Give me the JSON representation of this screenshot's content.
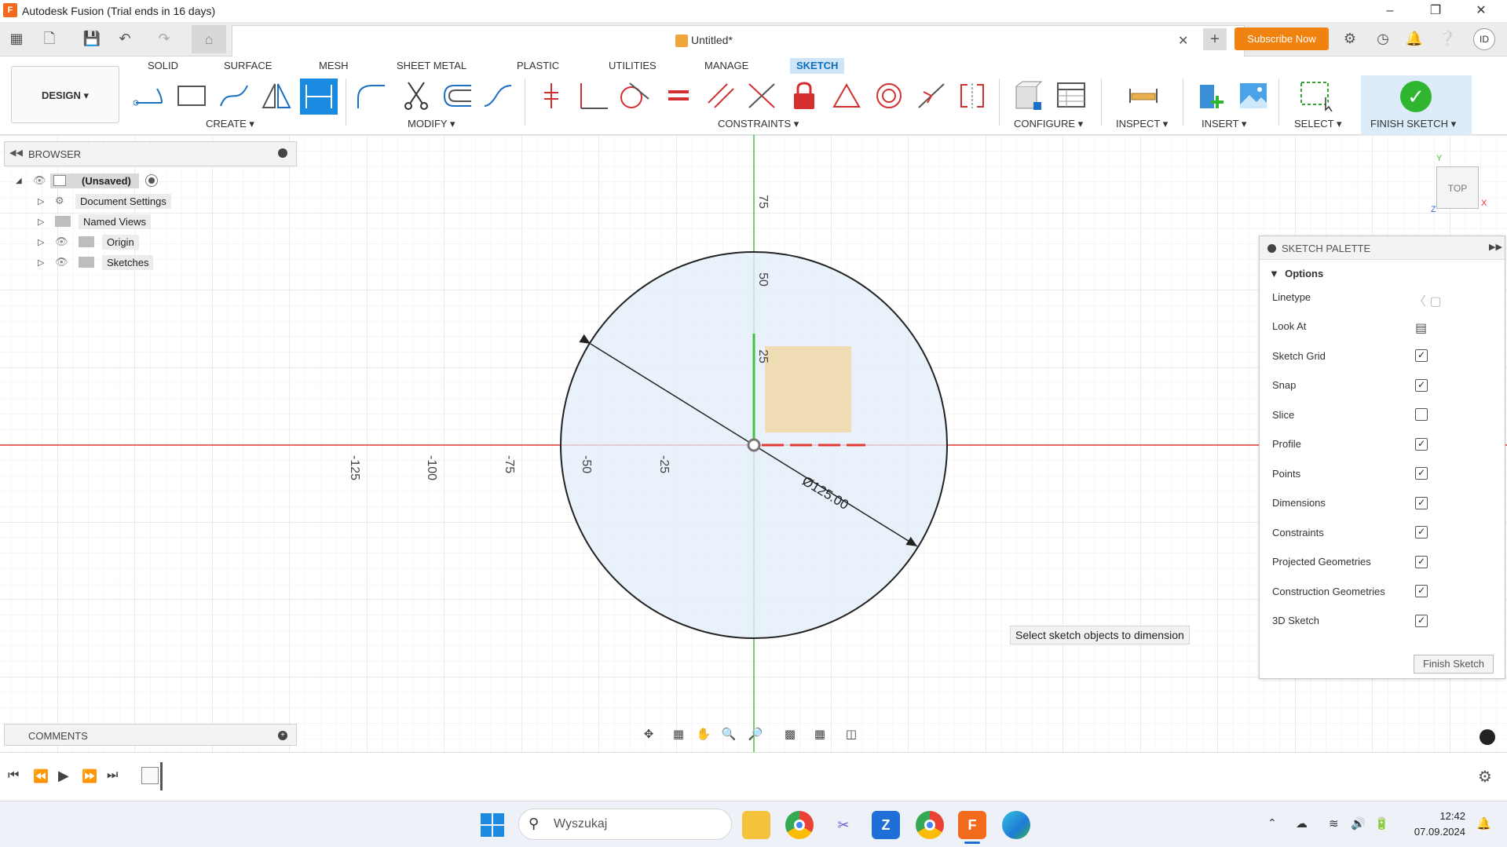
{
  "app": {
    "title": "Autodesk Fusion (Trial ends in 16 days)",
    "doc_tab": "Untitled*",
    "subscribe": "Subscribe Now",
    "user_initials": "ID"
  },
  "ribbon": {
    "workspace": "DESIGN",
    "tabs": [
      "SOLID",
      "SURFACE",
      "MESH",
      "SHEET METAL",
      "PLASTIC",
      "UTILITIES",
      "MANAGE",
      "SKETCH"
    ],
    "active_tab": "SKETCH",
    "groups": {
      "create": "CREATE",
      "modify": "MODIFY",
      "constraints": "CONSTRAINTS",
      "configure": "CONFIGURE",
      "inspect": "INSPECT",
      "insert": "INSERT",
      "select": "SELECT",
      "finish": "FINISH SKETCH"
    }
  },
  "browser": {
    "title": "BROWSER",
    "root": "(Unsaved)",
    "items": [
      "Document Settings",
      "Named Views",
      "Origin",
      "Sketches"
    ]
  },
  "comments": {
    "title": "COMMENTS"
  },
  "canvas": {
    "axis_labels_y": [
      "75",
      "50",
      "25"
    ],
    "axis_labels_x": [
      "-125",
      "-100",
      "-75",
      "-50",
      "-25"
    ],
    "dimension": "Ø125.00",
    "tooltip": "Select sketch objects to dimension",
    "viewcube": "TOP",
    "axis_x": "X",
    "axis_y": "Y",
    "axis_z": "Z"
  },
  "palette": {
    "title": "SKETCH PALETTE",
    "section": "Options",
    "rows": [
      {
        "label": "Linetype"
      },
      {
        "label": "Look At"
      },
      {
        "label": "Sketch Grid",
        "checked": true
      },
      {
        "label": "Snap",
        "checked": true
      },
      {
        "label": "Slice",
        "checked": false
      },
      {
        "label": "Profile",
        "checked": true
      },
      {
        "label": "Points",
        "checked": true
      },
      {
        "label": "Dimensions",
        "checked": true
      },
      {
        "label": "Constraints",
        "checked": true
      },
      {
        "label": "Projected Geometries",
        "checked": true
      },
      {
        "label": "Construction Geometries",
        "checked": true
      },
      {
        "label": "3D Sketch",
        "checked": true
      }
    ],
    "finish_button": "Finish Sketch"
  },
  "taskbar": {
    "search_placeholder": "Wyszukaj",
    "time": "12:42",
    "date": "07.09.2024"
  },
  "colors": {
    "accent": "#0f6eb9",
    "subscribe": "#f0820f",
    "x_axis": "#e53935",
    "y_axis": "#43c043",
    "finish_green": "#2fb52f"
  }
}
